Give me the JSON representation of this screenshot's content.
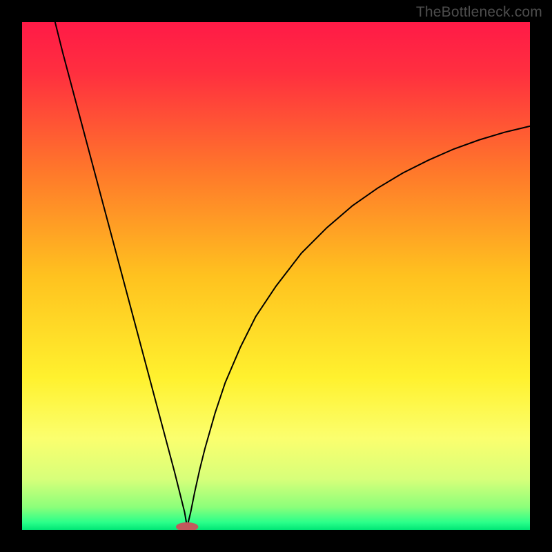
{
  "watermark": "TheBottleneck.com",
  "chart_data": {
    "type": "line",
    "title": "",
    "xlabel": "",
    "ylabel": "",
    "xlim": [
      0,
      100
    ],
    "ylim": [
      0,
      100
    ],
    "grid": false,
    "legend": false,
    "gradient_stops": [
      {
        "offset": 0.0,
        "color": "#ff1a47"
      },
      {
        "offset": 0.1,
        "color": "#ff2f3f"
      },
      {
        "offset": 0.3,
        "color": "#ff7a2a"
      },
      {
        "offset": 0.5,
        "color": "#ffc21f"
      },
      {
        "offset": 0.7,
        "color": "#fff12e"
      },
      {
        "offset": 0.82,
        "color": "#fbff6e"
      },
      {
        "offset": 0.9,
        "color": "#d7ff7a"
      },
      {
        "offset": 0.955,
        "color": "#8cff7a"
      },
      {
        "offset": 0.985,
        "color": "#2bff8a"
      },
      {
        "offset": 1.0,
        "color": "#00e676"
      }
    ],
    "min_marker": {
      "x": 32.5,
      "y": 0.6,
      "rx": 2.2,
      "ry": 0.9,
      "color": "#c2595c"
    },
    "series": [
      {
        "name": "left-branch",
        "x": [
          6.5,
          8,
          10,
          12,
          14,
          16,
          18,
          20,
          22,
          24,
          26,
          28,
          30,
          31,
          32,
          32.5
        ],
        "y": [
          100,
          94,
          86.5,
          79,
          71.5,
          64,
          56.5,
          49,
          41.5,
          34,
          26.5,
          19,
          11.5,
          7.5,
          3.5,
          0.6
        ]
      },
      {
        "name": "right-branch",
        "x": [
          32.5,
          33.2,
          34,
          35,
          36,
          38,
          40,
          43,
          46,
          50,
          55,
          60,
          65,
          70,
          75,
          80,
          85,
          90,
          95,
          100
        ],
        "y": [
          0.6,
          3.5,
          7.5,
          12,
          16,
          23,
          29,
          36,
          42,
          48,
          54.5,
          59.5,
          63.8,
          67.3,
          70.3,
          72.8,
          75.0,
          76.8,
          78.3,
          79.5
        ]
      }
    ]
  }
}
